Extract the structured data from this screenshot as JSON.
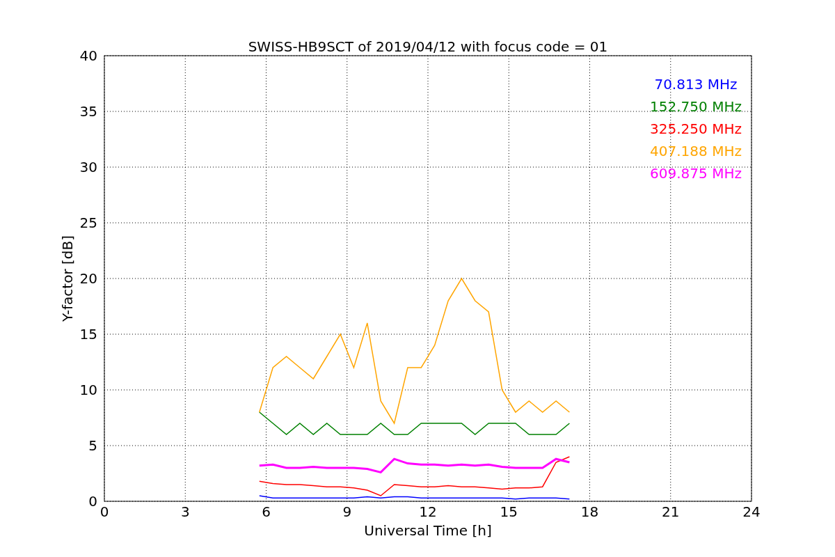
{
  "chart_data": {
    "type": "line",
    "title": "SWISS-HB9SCT of 2019/04/12 with focus code = 01",
    "xlabel": "Universal Time [h]",
    "ylabel": "Y-factor [dB]",
    "xlim": [
      0,
      24
    ],
    "ylim": [
      0,
      40
    ],
    "grid": true,
    "xticks": [
      0,
      3,
      6,
      9,
      12,
      15,
      18,
      21,
      24
    ],
    "yticks": [
      0,
      5,
      10,
      15,
      20,
      25,
      30,
      35,
      40
    ],
    "x": [
      5.75,
      6.25,
      6.75,
      7.25,
      7.75,
      8.25,
      8.75,
      9.25,
      9.75,
      10.25,
      10.75,
      11.25,
      11.75,
      12.25,
      12.75,
      13.25,
      13.75,
      14.25,
      14.75,
      15.25,
      15.75,
      16.25,
      16.75,
      17.25
    ],
    "series": [
      {
        "name": "70.813 MHz",
        "color": "#0000ff",
        "values": [
          0.5,
          0.3,
          0.3,
          0.3,
          0.3,
          0.3,
          0.3,
          0.3,
          0.4,
          0.3,
          0.4,
          0.4,
          0.3,
          0.3,
          0.3,
          0.3,
          0.3,
          0.3,
          0.3,
          0.2,
          0.3,
          0.3,
          0.3,
          0.2
        ]
      },
      {
        "name": "152.750 MHz",
        "color": "#008000",
        "values": [
          8,
          7,
          6,
          7,
          6,
          7,
          6,
          6,
          6,
          7,
          6,
          6,
          7,
          7,
          7,
          7,
          6,
          7,
          7,
          7,
          6,
          6,
          6,
          7
        ]
      },
      {
        "name": "325.250 MHz",
        "color": "#ff0000",
        "values": [
          1.8,
          1.6,
          1.5,
          1.5,
          1.4,
          1.3,
          1.3,
          1.2,
          1.0,
          0.5,
          1.5,
          1.4,
          1.3,
          1.3,
          1.4,
          1.3,
          1.3,
          1.2,
          1.1,
          1.2,
          1.2,
          1.3,
          3.5,
          4.0
        ]
      },
      {
        "name": "407.188 MHz",
        "color": "#ffa500",
        "values": [
          8,
          12,
          13,
          12,
          11,
          13,
          15,
          12,
          16,
          9,
          7,
          12,
          12,
          14,
          18,
          20,
          18,
          17,
          10,
          8,
          9,
          8,
          9,
          8
        ]
      },
      {
        "name": "609.875 MHz",
        "color": "#ff00ff",
        "values": [
          3.2,
          3.3,
          3.0,
          3.0,
          3.1,
          3.0,
          3.0,
          3.0,
          2.9,
          2.6,
          3.8,
          3.4,
          3.3,
          3.3,
          3.2,
          3.3,
          3.2,
          3.3,
          3.1,
          3.0,
          3.0,
          3.0,
          3.8,
          3.5
        ]
      }
    ]
  }
}
